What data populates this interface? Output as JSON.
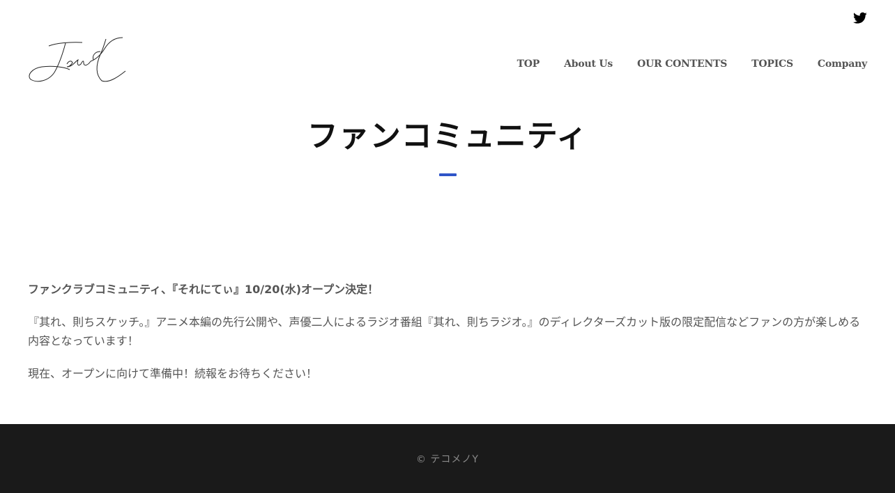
{
  "header": {
    "social_icon": "twitter-icon",
    "logo_icon": "signature-logo-icon",
    "nav": [
      {
        "label": "TOP"
      },
      {
        "label": "About Us"
      },
      {
        "label": "OUR CONTENTS"
      },
      {
        "label": "TOPICS"
      },
      {
        "label": "Company"
      }
    ]
  },
  "hero": {
    "title": "ファンコミュニティ"
  },
  "content": {
    "headline": "ファンクラブコミュニティ、『それにてぃ』10/20(水)オープン決定！",
    "paragraph1": "『其れ、則ちスケッチ。』アニメ本編の先行公開や、声優二人によるラジオ番組『其れ、則ちラジオ。』のディレクターズカット版の限定配信などファンの方が楽しめる内容となっています！",
    "paragraph2": "現在、オープンに向けて準備中！続報をお待ちください！"
  },
  "footer": {
    "copyright": "© テコメノY"
  },
  "colors": {
    "accent": "#2f55c8",
    "footer_bg": "#1a1a1a",
    "text": "#555555",
    "title": "#111111"
  }
}
